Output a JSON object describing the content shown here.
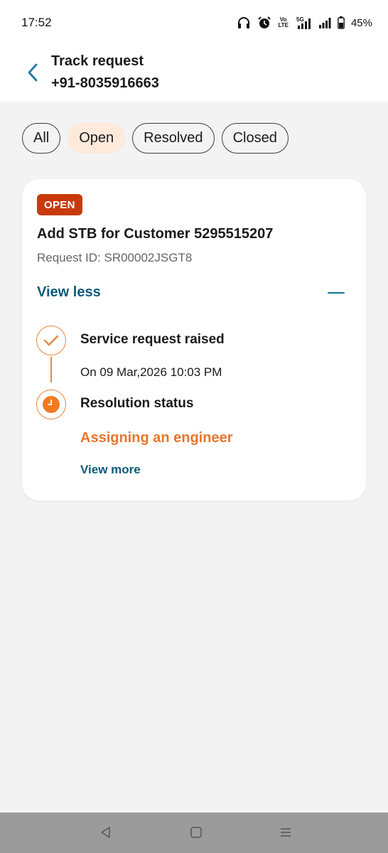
{
  "status_bar": {
    "time": "17:52",
    "volte_label": "Vo\nLTE",
    "network_label": "5G",
    "battery": "45%",
    "icons": [
      "headphones-icon",
      "alarm-icon",
      "volte-icon",
      "5g-signal-icon",
      "signal-icon",
      "battery-icon"
    ]
  },
  "header": {
    "title": "Track request",
    "subtitle": "+91-8035916663",
    "back_icon": "chevron-left-icon"
  },
  "filters": [
    {
      "label": "All",
      "active": false
    },
    {
      "label": "Open",
      "active": true
    },
    {
      "label": "Resolved",
      "active": false
    },
    {
      "label": "Closed",
      "active": false
    }
  ],
  "request": {
    "badge": "OPEN",
    "title": "Add STB for Customer 5295515207",
    "request_id": "Request ID: SR00002JSGT8",
    "view_less": "View less",
    "steps": [
      {
        "title": "Service request raised",
        "detail": "On 09 Mar,2026 10:03 PM",
        "icon": "check-icon"
      },
      {
        "title": "Resolution status",
        "detail": "Assigning an engineer",
        "icon": "clock-icon"
      }
    ],
    "view_more": "View more"
  },
  "colors": {
    "accent_orange": "#e8762c",
    "badge_red": "#c83a0b",
    "link_blue": "#0d5a7a",
    "chip_active_bg": "#fdeadb"
  },
  "nav_bar": {
    "icons": [
      "back-triangle-icon",
      "home-square-icon",
      "recents-menu-icon"
    ]
  }
}
